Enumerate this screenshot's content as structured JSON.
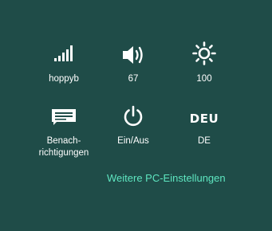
{
  "colors": {
    "background": "#1f4c48",
    "foreground": "#ffffff",
    "link": "#5ee6c0"
  },
  "tiles": [
    {
      "id": "network",
      "icon": "signal-bars-icon",
      "label": "hoppyb"
    },
    {
      "id": "volume",
      "icon": "speaker-icon",
      "label": "67"
    },
    {
      "id": "brightness",
      "icon": "sun-icon",
      "label": "100"
    },
    {
      "id": "notifications",
      "icon": "notifications-icon",
      "label_line1": "Benach-",
      "label_line2": "richtigungen"
    },
    {
      "id": "power",
      "icon": "power-icon",
      "label": "Ein/Aus"
    },
    {
      "id": "language",
      "code": "DEU",
      "label": "DE"
    }
  ],
  "more_settings_link": "Weitere PC-Einstellungen"
}
